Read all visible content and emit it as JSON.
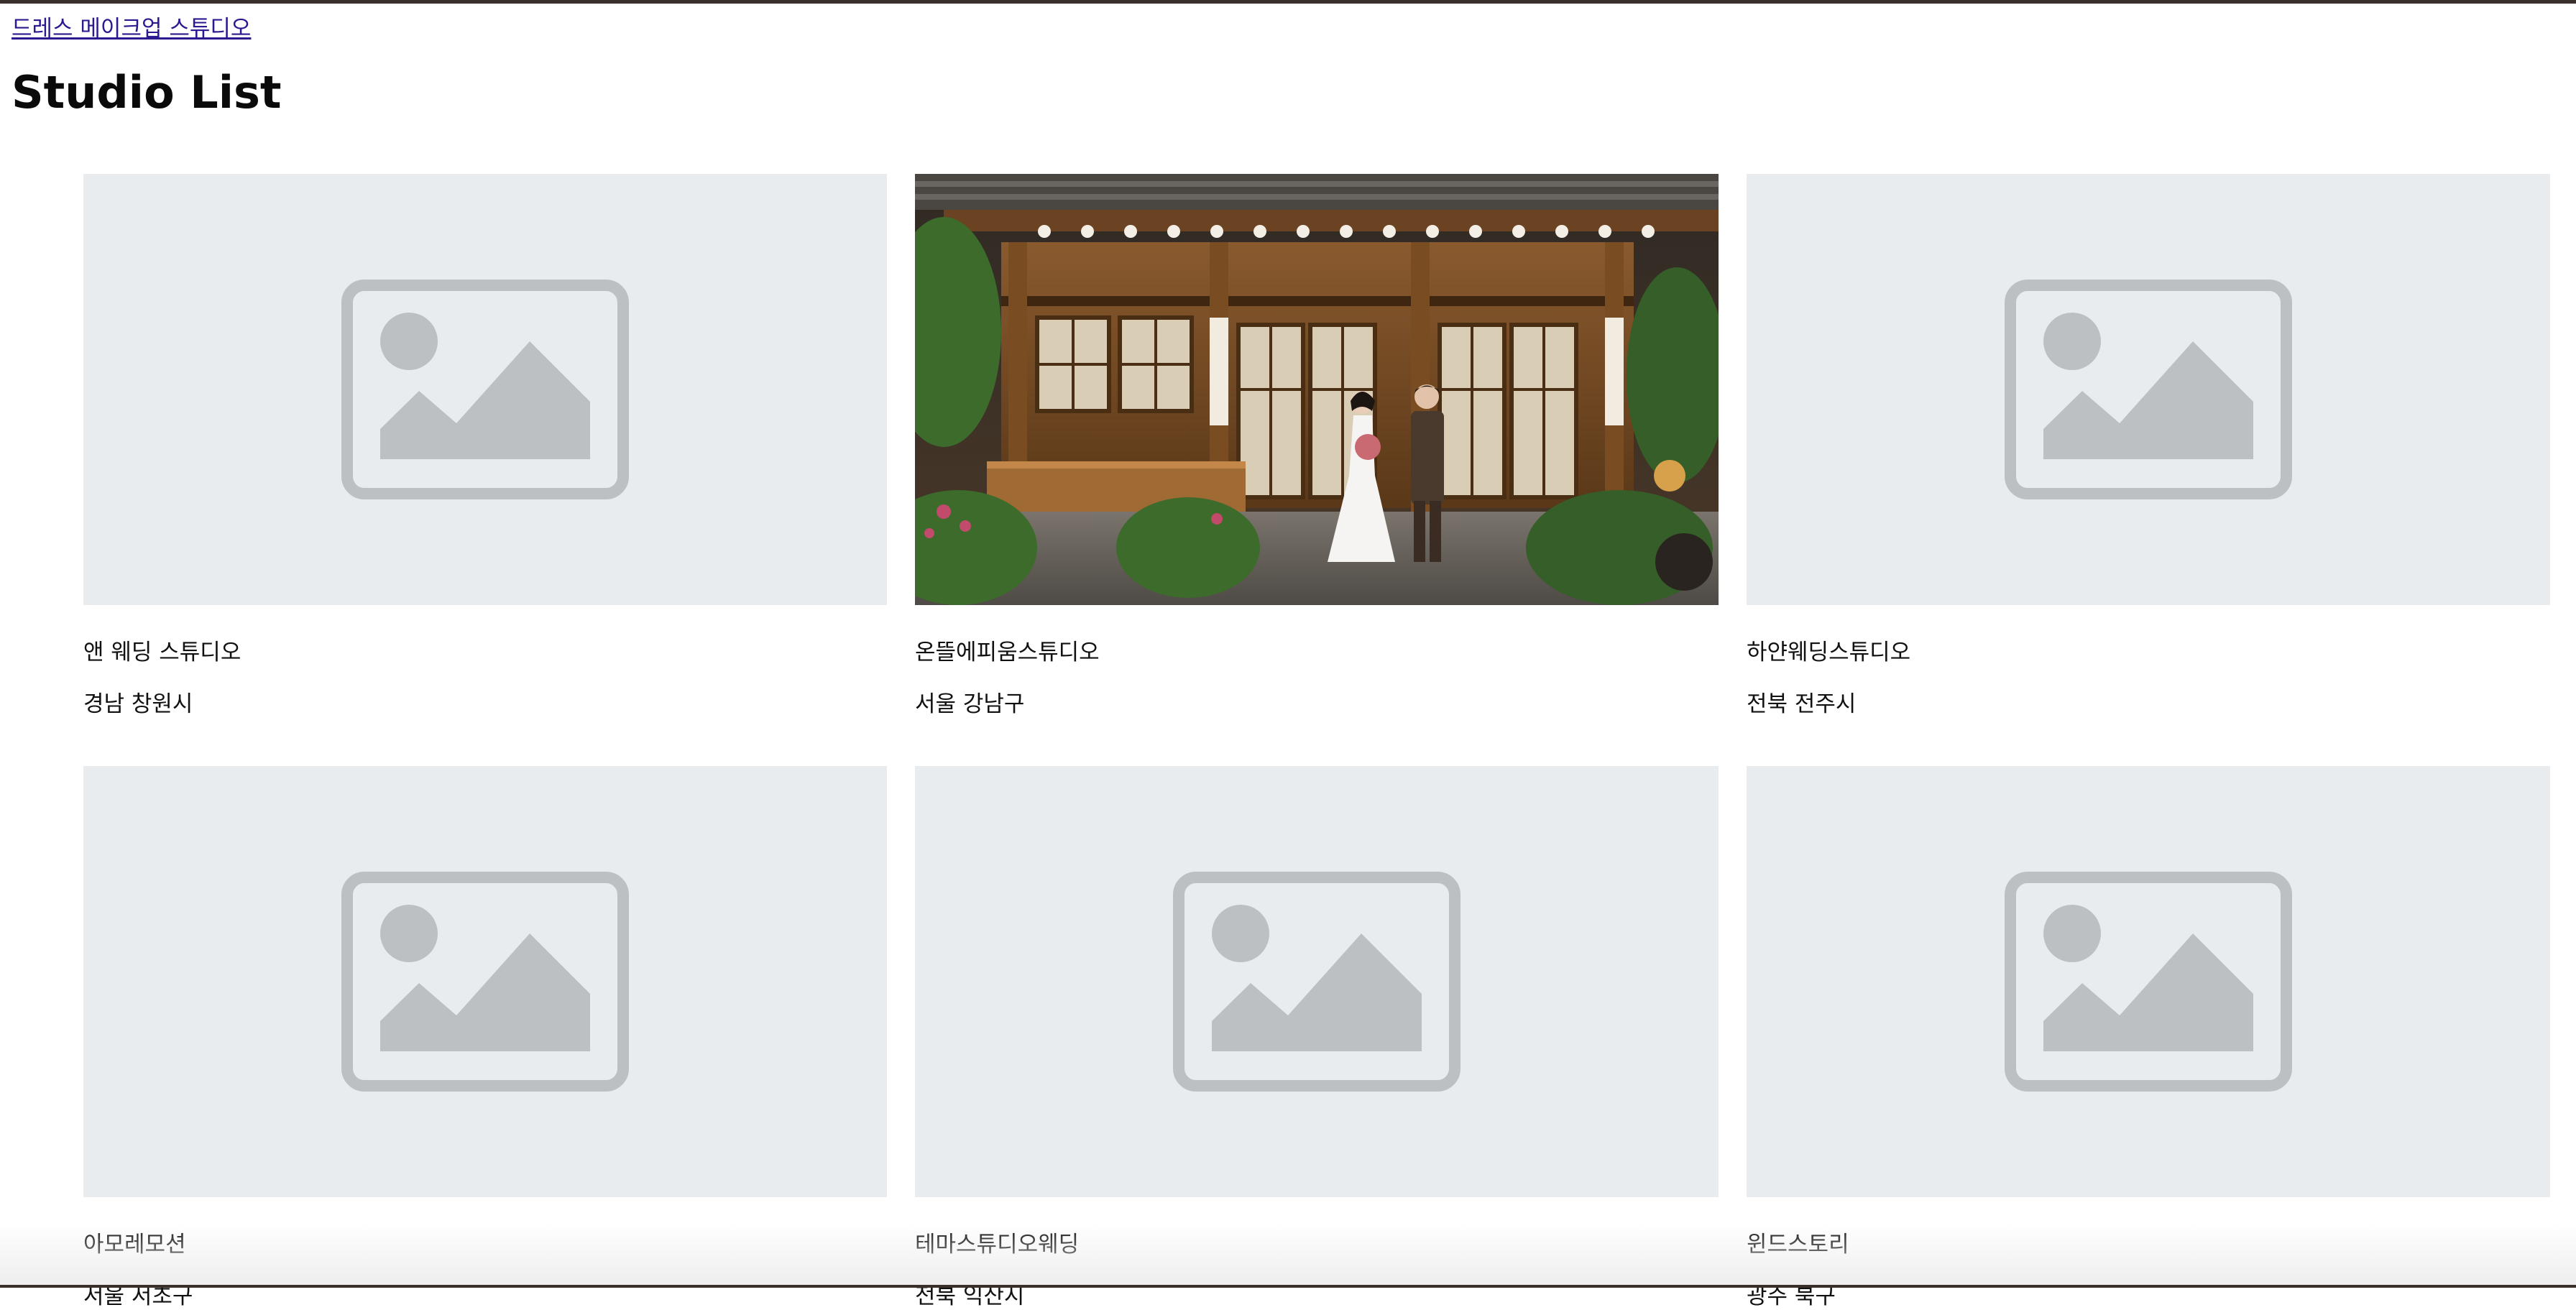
{
  "header": {
    "site_link": "드레스 메이크업 스튜디오"
  },
  "page": {
    "title": "Studio List"
  },
  "studios": [
    {
      "name": "앤 웨딩 스튜디오",
      "location": "경남 창원시",
      "image": "placeholder-icon"
    },
    {
      "name": "온뜰에피움스튜디오",
      "location": "서울 강남구",
      "image": "hanok-wedding-photo"
    },
    {
      "name": "하얀웨딩스튜디오",
      "location": "전북 전주시",
      "image": "placeholder-icon"
    },
    {
      "name": "아모레모션",
      "location": "서울 서초구",
      "image": "placeholder-icon"
    },
    {
      "name": "테마스튜디오웨딩",
      "location": "전북 익산시",
      "image": "placeholder-icon"
    },
    {
      "name": "윈드스토리",
      "location": "광주 북구",
      "image": "placeholder-icon"
    }
  ],
  "colors": {
    "placeholder_bg": "#e9ecef",
    "placeholder_icon": "#bdc0c3",
    "link": "#2b1a8f"
  }
}
